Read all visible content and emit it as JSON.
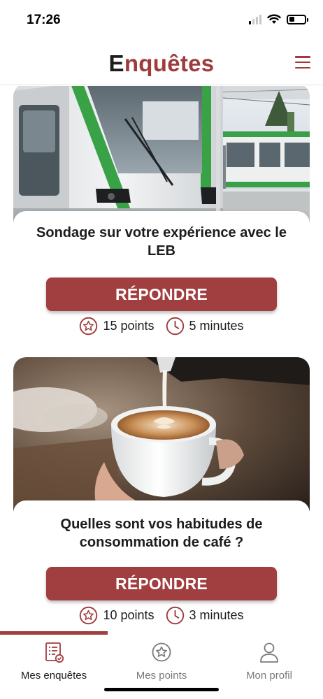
{
  "status_bar": {
    "time": "17:26",
    "battery_level": 0.35
  },
  "header": {
    "title_first": "E",
    "title_rest": "nquêtes",
    "menu_icon": "hamburger-icon"
  },
  "surveys": [
    {
      "image": "train-photo",
      "title": "Sondage sur votre expérience avec le LEB",
      "button_label": "RÉPONDRE",
      "points": "15 points",
      "duration": "5 minutes"
    },
    {
      "image": "coffee-photo",
      "title": "Quelles sont vos habitudes de consommation de café ?",
      "button_label": "RÉPONDRE",
      "points": "10 points",
      "duration": "3 minutes"
    }
  ],
  "tabs": [
    {
      "label": "Mes enquêtes",
      "icon": "survey-list-icon",
      "active": true
    },
    {
      "label": "Mes points",
      "icon": "star-circle-icon",
      "active": false
    },
    {
      "label": "Mon profil",
      "icon": "user-icon",
      "active": false
    }
  ],
  "colors": {
    "accent": "#a13e40",
    "text": "#1c1c1c",
    "muted": "#7a7a7a"
  }
}
